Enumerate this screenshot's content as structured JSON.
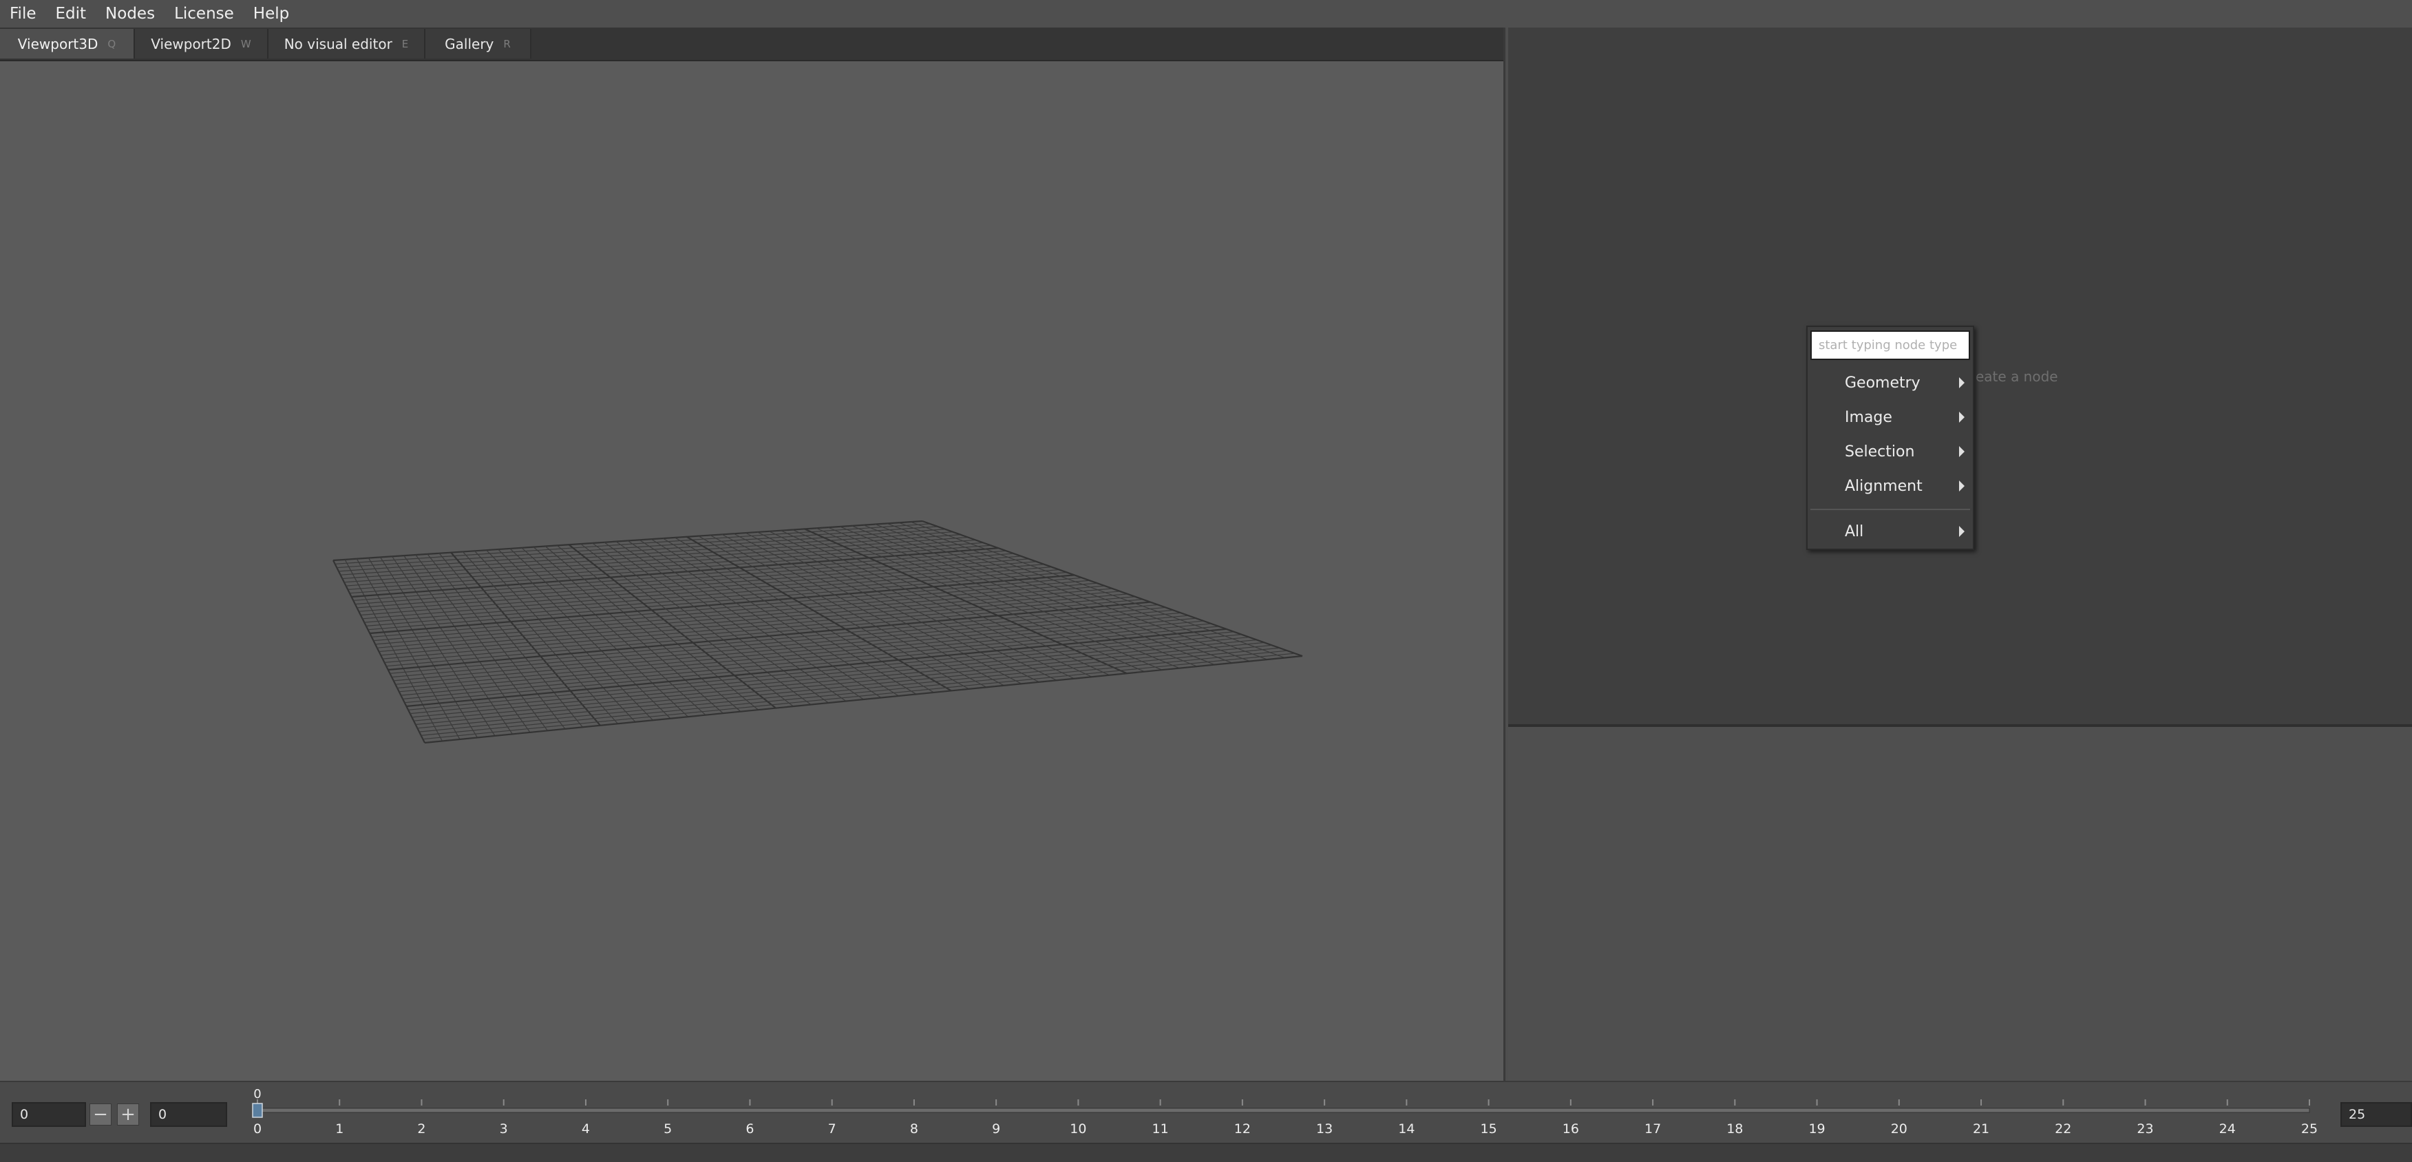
{
  "menubar": {
    "items": [
      "File",
      "Edit",
      "Nodes",
      "License",
      "Help"
    ]
  },
  "tabs": [
    {
      "label": "Viewport3D",
      "shortcut": "Q",
      "active": true
    },
    {
      "label": "Viewport2D",
      "shortcut": "W",
      "active": false
    },
    {
      "label": "No visual editor",
      "shortcut": "E",
      "active": false
    },
    {
      "label": "Gallery",
      "shortcut": "R",
      "active": false
    }
  ],
  "node_editor": {
    "hint": "eate a node",
    "context_menu": {
      "search_placeholder": "start typing node type",
      "items": [
        "Geometry",
        "Image",
        "Selection",
        "Alignment"
      ],
      "all_label": "All"
    }
  },
  "timeline": {
    "current_frame_value": "0",
    "start_frame_value": "0",
    "end_frame_value": "25",
    "playhead_label": "0",
    "playhead_frame": 0,
    "min_frame": 0,
    "max_frame": 25,
    "tick_labels": [
      "0",
      "1",
      "2",
      "3",
      "4",
      "5",
      "6",
      "7",
      "8",
      "9",
      "10",
      "11",
      "12",
      "13",
      "14",
      "15",
      "16",
      "17",
      "18",
      "19",
      "20",
      "21",
      "22",
      "23",
      "24",
      "25"
    ]
  },
  "colors": {
    "viewport_bg": "#5b5b5b",
    "grid_line": "#3a3a3a",
    "node_pane_bg": "#3f3f3f",
    "accent_playhead": "#5a7fa0"
  },
  "icons": {
    "decrement": "minus-icon",
    "increment": "plus-icon",
    "submenu": "chevron-right-icon"
  }
}
